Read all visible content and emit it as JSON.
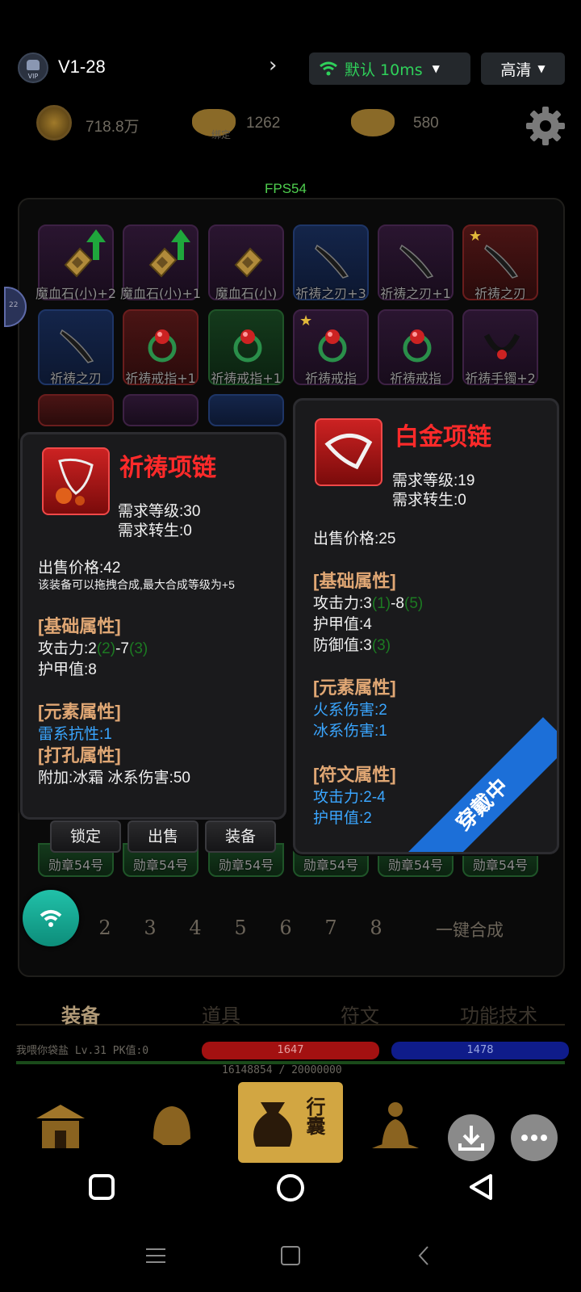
{
  "topbar": {
    "version": "V1-28",
    "vip_label": "VIP",
    "network_label": "默认 10ms",
    "quality_label": "高清"
  },
  "currency": {
    "gold": "718.8万",
    "bound_ingot": "1262",
    "bound_tag": "绑定",
    "ingot": "580"
  },
  "fps": "FPS54",
  "side_tab": "22",
  "bag": {
    "items": [
      {
        "name": "魔血石(小)+2",
        "quality": "purple",
        "icon": "gem-icon",
        "upgrade": true
      },
      {
        "name": "魔血石(小)+1",
        "quality": "purple",
        "icon": "gem-icon",
        "upgrade": true
      },
      {
        "name": "魔血石(小)",
        "quality": "purple",
        "icon": "gem-icon"
      },
      {
        "name": "祈祷之刃+3",
        "quality": "blue",
        "icon": "blade-icon"
      },
      {
        "name": "祈祷之刃+1",
        "quality": "purple",
        "icon": "blade-icon"
      },
      {
        "name": "祈祷之刃",
        "quality": "red",
        "icon": "blade-icon",
        "star": true
      },
      {
        "name": "祈祷之刃",
        "quality": "blue",
        "icon": "blade-icon"
      },
      {
        "name": "祈祷戒指+1",
        "quality": "red",
        "icon": "ring-icon"
      },
      {
        "name": "祈祷戒指+1",
        "quality": "green",
        "icon": "ring-icon"
      },
      {
        "name": "祈祷戒指",
        "quality": "purple",
        "icon": "ring-icon",
        "star": true
      },
      {
        "name": "祈祷戒指",
        "quality": "purple",
        "icon": "ring-icon"
      },
      {
        "name": "祈祷手镯+2",
        "quality": "purple",
        "icon": "bracelet-icon"
      }
    ],
    "medal_label": "勋章54号",
    "pages": [
      "2",
      "3",
      "4",
      "5",
      "6",
      "7",
      "8"
    ],
    "merge_label": "一键合成"
  },
  "tooltip_left": {
    "title": "祈祷项链",
    "req_level": "需求等级:30",
    "req_rebirth": "需求转生:0",
    "price": "出售价格:42",
    "note": "该装备可以拖拽合成,最大合成等级为+5",
    "basic_header": "[基础属性]",
    "attack_prefix": "攻击力:2",
    "attack_g1": "(2)",
    "attack_mid": "-7",
    "attack_g2": "(3)",
    "armor": "护甲值:8",
    "element_header": "[元素属性]",
    "element_line": "雷系抗性:1",
    "socket_header": "[打孔属性]",
    "socket_line": "附加:冰霜 冰系伤害:50",
    "btn_lock": "锁定",
    "btn_sell": "出售",
    "btn_equip": "装备"
  },
  "tooltip_right": {
    "title": "白金项链",
    "req_level": "需求等级:19",
    "req_rebirth": "需求转生:0",
    "price": "出售价格:25",
    "basic_header": "[基础属性]",
    "attack_prefix": "攻击力:3",
    "attack_g1": "(1)",
    "attack_mid": "-8",
    "attack_g2": "(5)",
    "armor": "护甲值:4",
    "defense_prefix": "防御值:3",
    "defense_g": "(3)",
    "element_header": "[元素属性]",
    "fire": "火系伤害:2",
    "ice": "冰系伤害:1",
    "rune_header": "[符文属性]",
    "rune_attack": "攻击力:2-4",
    "rune_armor": "护甲值:2",
    "ribbon": "穿戴中"
  },
  "bottom": {
    "tabs": [
      "装备",
      "道具",
      "符文",
      "功能技术"
    ],
    "player": "我喂你袋盐  Lv.31 PK值:0",
    "hp": "1647",
    "mp": "1478",
    "xp": "16148854 / 20000000",
    "bag_button": "行囊"
  },
  "colors": {
    "title_red": "#ff2a2a",
    "section_orange": "#e0a774",
    "element_cyan": "#3aa6ff",
    "bonus_green": "#1c7a22",
    "network_green": "#2fd15a",
    "ribbon_blue": "#1c6fd8"
  }
}
